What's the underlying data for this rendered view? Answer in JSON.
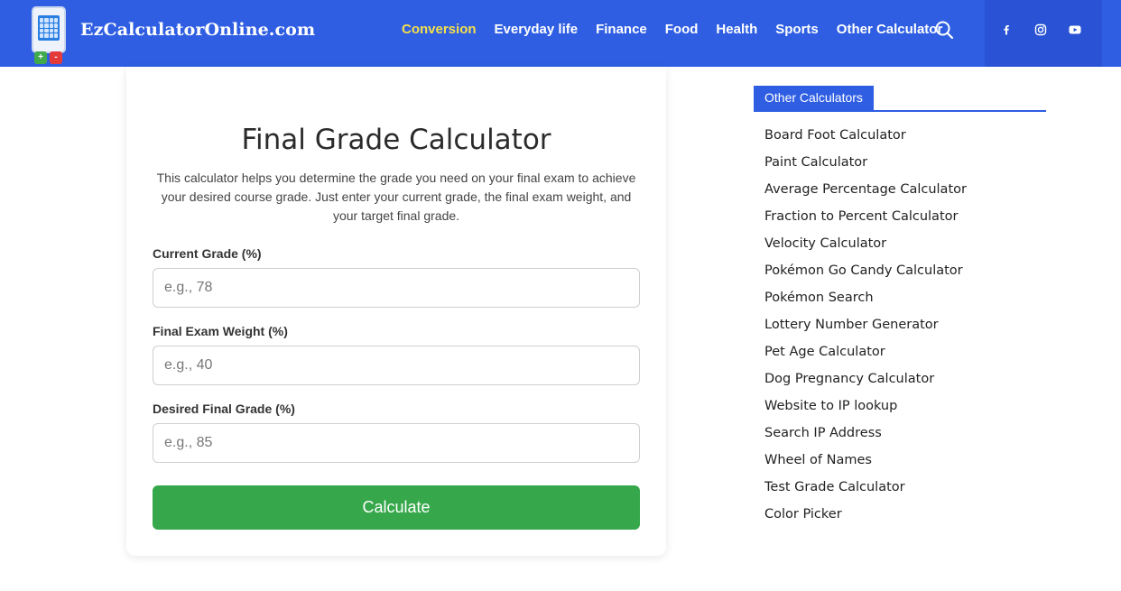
{
  "header": {
    "brand": "EzCalculatorOnline.com",
    "nav": [
      {
        "label": "Conversion"
      },
      {
        "label": "Everyday life"
      },
      {
        "label": "Finance"
      },
      {
        "label": "Food"
      },
      {
        "label": "Health"
      },
      {
        "label": "Sports"
      },
      {
        "label": "Other Calculator"
      }
    ],
    "active_nav": "Conversion",
    "active_color": "#f4e04a",
    "brand_color": "#2f5ee3",
    "icons": [
      "search-icon",
      "facebook-icon",
      "instagram-icon",
      "youtube-icon"
    ]
  },
  "calculator": {
    "title": "Final Grade Calculator",
    "description": "This calculator helps you determine the grade you need on your final exam to achieve your desired course grade. Just enter your current grade, the final exam weight, and your target final grade.",
    "fields": [
      {
        "label": "Current Grade (%)",
        "placeholder": "e.g., 78",
        "value": ""
      },
      {
        "label": "Final Exam Weight (%)",
        "placeholder": "e.g., 40",
        "value": ""
      },
      {
        "label": "Desired Final Grade (%)",
        "placeholder": "e.g., 85",
        "value": ""
      }
    ],
    "button_label": "Calculate",
    "button_color": "#36a84b"
  },
  "sidebar": {
    "title": "Other Calculators",
    "items": [
      {
        "label": "Board Foot Calculator"
      },
      {
        "label": "Paint Calculator"
      },
      {
        "label": "Average Percentage Calculator"
      },
      {
        "label": "Fraction to Percent Calculator"
      },
      {
        "label": "Velocity Calculator"
      },
      {
        "label": "Pokémon Go Candy Calculator"
      },
      {
        "label": "Pokémon Search"
      },
      {
        "label": "Lottery Number Generator"
      },
      {
        "label": "Pet Age Calculator"
      },
      {
        "label": "Dog Pregnancy Calculator"
      },
      {
        "label": "Website to IP lookup"
      },
      {
        "label": "Search IP Address"
      },
      {
        "label": "Wheel of Names"
      },
      {
        "label": "Test Grade Calculator"
      },
      {
        "label": "Color Picker"
      }
    ]
  }
}
